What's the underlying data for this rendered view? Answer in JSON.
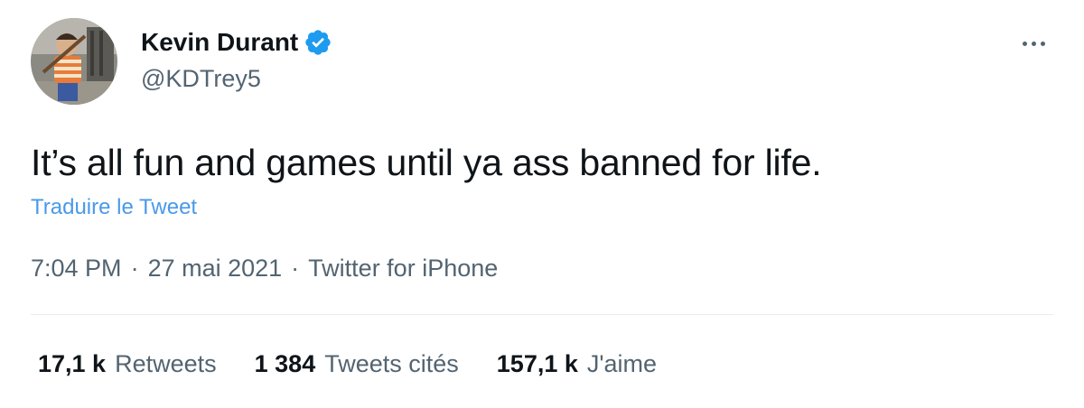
{
  "author": {
    "display_name": "Kevin Durant",
    "handle": "@KDTrey5",
    "verified": true,
    "avatar_icon": "profile-photo"
  },
  "tweet": {
    "text": "It’s all fun and games until ya ass banned for life.",
    "translate_label": "Traduire le Tweet"
  },
  "meta": {
    "time": "7:04 PM",
    "separator": "·",
    "date": "27 mai 2021",
    "source": "Twitter for iPhone"
  },
  "stats": [
    {
      "count": "17,1 k",
      "label": "Retweets"
    },
    {
      "count": "1 384",
      "label": "Tweets cités"
    },
    {
      "count": "157,1 k",
      "label": "J'aime"
    }
  ],
  "colors": {
    "text_primary": "#0f1419",
    "text_secondary": "#536471",
    "link": "#4a99e9",
    "verified": "#1d9bf0",
    "divider": "#e6ecf0"
  }
}
